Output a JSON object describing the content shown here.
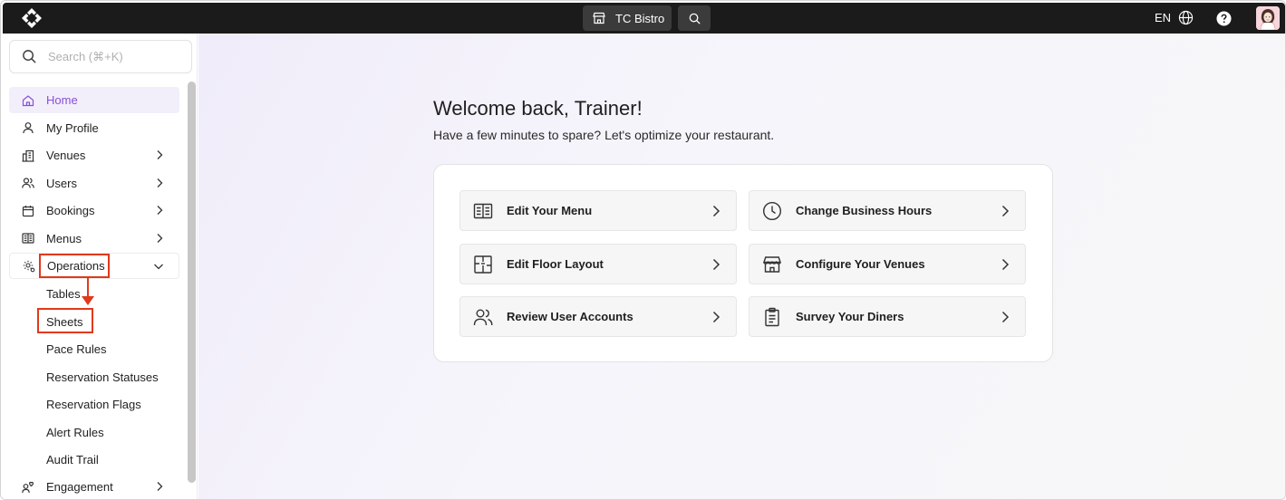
{
  "topbar": {
    "venue_name": "TC Bistro",
    "language": "EN"
  },
  "sidebar": {
    "search_placeholder": "Search (⌘+K)",
    "items": [
      {
        "label": "Home",
        "icon": "home-icon"
      },
      {
        "label": "My Profile",
        "icon": "user-icon"
      },
      {
        "label": "Venues",
        "icon": "building-icon"
      },
      {
        "label": "Users",
        "icon": "users-icon"
      },
      {
        "label": "Bookings",
        "icon": "calendar-icon"
      },
      {
        "label": "Menus",
        "icon": "menu-book-icon"
      },
      {
        "label": "Operations",
        "icon": "gear-icon"
      }
    ],
    "operations_sub": [
      {
        "label": "Tables"
      },
      {
        "label": "Sheets"
      },
      {
        "label": "Pace Rules"
      },
      {
        "label": "Reservation Statuses"
      },
      {
        "label": "Reservation Flags"
      },
      {
        "label": "Alert Rules"
      },
      {
        "label": "Audit Trail"
      }
    ],
    "engagement": {
      "label": "Engagement",
      "icon": "engagement-icon"
    }
  },
  "main": {
    "title": "Welcome back, Trainer!",
    "subtitle": "Have a few minutes to spare? Let's optimize your restaurant.",
    "actions": [
      {
        "label": "Edit Your Menu",
        "icon": "menu-book-icon"
      },
      {
        "label": "Change Business Hours",
        "icon": "clock-icon"
      },
      {
        "label": "Edit Floor Layout",
        "icon": "floor-layout-icon"
      },
      {
        "label": "Configure Your Venues",
        "icon": "storefront-icon"
      },
      {
        "label": "Review User Accounts",
        "icon": "users-icon"
      },
      {
        "label": "Survey Your Diners",
        "icon": "clipboard-icon"
      }
    ]
  },
  "colors": {
    "topbar": "#1b1b1b",
    "accent": "#8a4fd6",
    "annotation": "#e0391b"
  }
}
